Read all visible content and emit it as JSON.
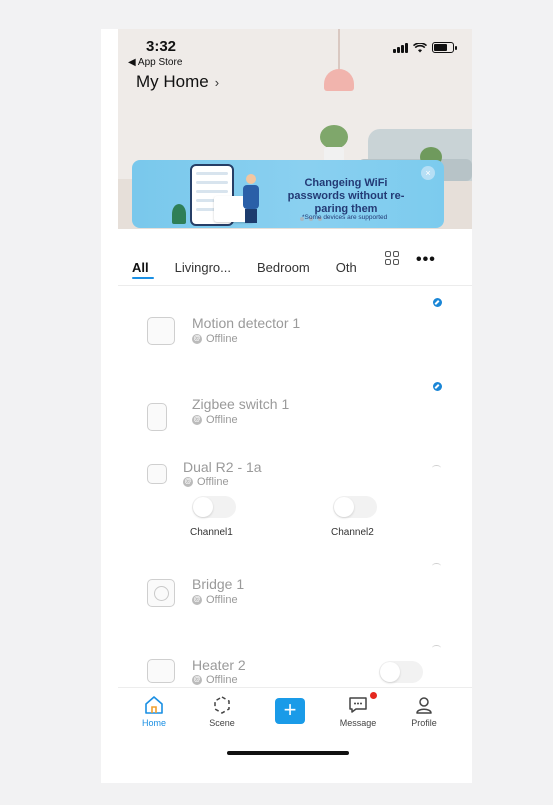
{
  "status_bar": {
    "time": "3:32",
    "back_label": "◀ App Store"
  },
  "header": {
    "home_title": "My Home",
    "chevron": "›"
  },
  "banner": {
    "headline": "Changeing WiFi passwords without re-paring them",
    "note": "*Some devices are supported",
    "close_glyph": "×"
  },
  "tabs": [
    {
      "label": "All",
      "active": true
    },
    {
      "label": "Livingro...",
      "active": false
    },
    {
      "label": "Bedroom",
      "active": false
    },
    {
      "label": "Oth",
      "active": false
    }
  ],
  "more_glyph": "•••",
  "devices": [
    {
      "name": "Motion detector 1",
      "status": "Offline",
      "icon": "motion-sensor-icon"
    },
    {
      "name": "Zigbee switch 1",
      "status": "Offline",
      "icon": "zigbee-switch-icon"
    },
    {
      "name": "Dual R2 - 1a",
      "status": "Offline",
      "icon": "dual-switch-icon",
      "channels": [
        "Channel1",
        "Channel2"
      ]
    },
    {
      "name": "Bridge 1",
      "status": "Offline",
      "icon": "bridge-icon"
    },
    {
      "name": "Heater 2",
      "status": "Offline",
      "icon": "heater-icon"
    }
  ],
  "offline_glyph": "@",
  "nav": [
    {
      "label": "Home",
      "active": true,
      "icon": "home-icon"
    },
    {
      "label": "Scene",
      "active": false,
      "icon": "scene-icon"
    },
    {
      "label": "Message",
      "active": false,
      "icon": "message-icon"
    },
    {
      "label": "Profile",
      "active": false,
      "icon": "profile-icon"
    }
  ],
  "add_glyph": "+",
  "colors": {
    "accent": "#1a8fe3",
    "banner_bg": "#7ccbee",
    "notification": "#e5281f"
  }
}
